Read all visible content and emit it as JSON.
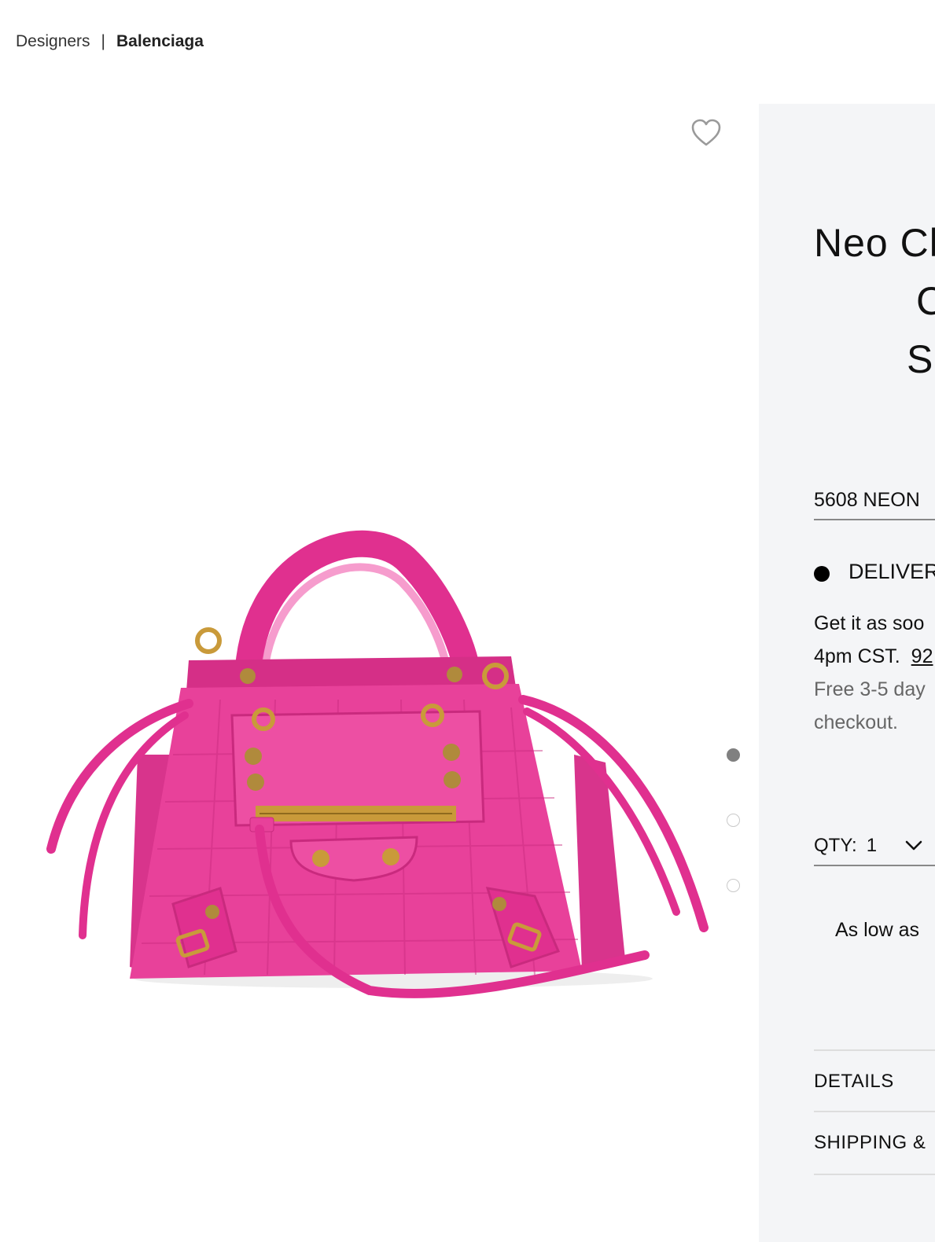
{
  "breadcrumb": {
    "parent": "Designers",
    "separator": "|",
    "current": "Balenciaga"
  },
  "gallery": {
    "wishlist_icon": "heart-outline-icon",
    "image_alt": "pink croc-embossed mini handbag",
    "slide_count": 3,
    "active_slide": 1
  },
  "product": {
    "title_lines": [
      "Neo Cl",
      "Cro",
      "S"
    ],
    "color_value": "5608 NEON",
    "delivery_label": "DELIVER",
    "delivery_line1": "Get it as soo",
    "delivery_line2_prefix": "4pm CST.",
    "delivery_line2_link": "92",
    "shipping_line1": "Free 3-5 day",
    "shipping_line2": "checkout.",
    "qty_label": "QTY:",
    "qty_value": "1",
    "affirm_text": "As low as",
    "accordion_details": "DETAILS",
    "accordion_shipping": "SHIPPING &"
  },
  "colors": {
    "panel_bg": "#f4f5f7",
    "bag_pink": "#e8419a",
    "hardware_gold": "#c99a3a"
  }
}
